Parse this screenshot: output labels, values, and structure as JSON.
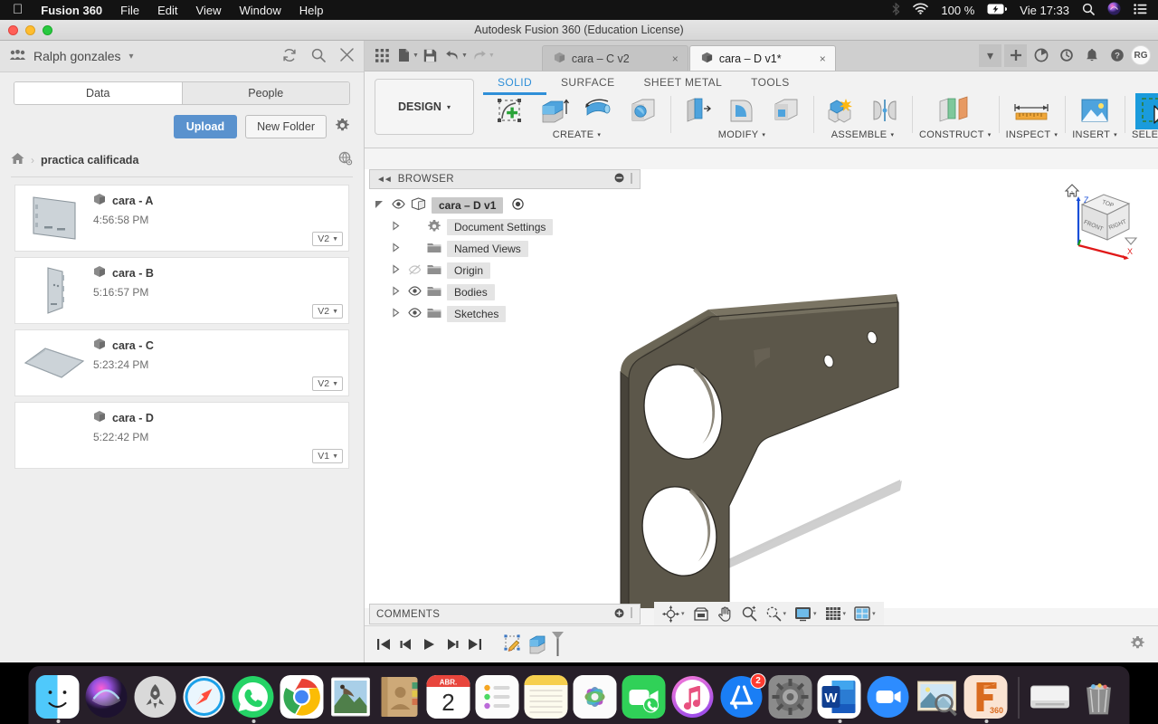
{
  "macbar": {
    "apple_icon": "apple-logo",
    "app_name": "Fusion 360",
    "menus": [
      "File",
      "Edit",
      "View",
      "Window",
      "Help"
    ],
    "bluetooth_icon": "bluetooth-icon",
    "wifi_icon": "wifi-icon",
    "battery_percent": "100 %",
    "battery_icon": "battery-charging-icon",
    "clock": "Vie 17:33",
    "search_icon": "spotlight-search-icon",
    "siri_icon": "siri-icon",
    "controlcenter_icon": "control-center-icon"
  },
  "window": {
    "title": "Autodesk Fusion 360 (Education License)"
  },
  "data_panel": {
    "user_name": "Ralph gonzales",
    "group_icon": "people-group-icon",
    "caret_icon": "chevron-down-icon",
    "refresh_icon": "refresh-icon",
    "search_icon": "search-icon",
    "close_icon": "close-icon",
    "tabs": [
      {
        "label": "Data",
        "active": true
      },
      {
        "label": "People",
        "active": false
      }
    ],
    "upload_label": "Upload",
    "new_folder_label": "New Folder",
    "settings_icon": "gear-icon",
    "breadcrumb": {
      "home_icon": "home-icon",
      "separator": "›",
      "folder": "practica calificada",
      "globe_icon": "globe-share-icon"
    },
    "items": [
      {
        "name": "cara - A",
        "time": "4:56:58 PM",
        "version": "V2",
        "thumb": "plate-flat-thumb"
      },
      {
        "name": "cara - B",
        "time": "5:16:57 PM",
        "version": "V2",
        "thumb": "plate-tall-thumb"
      },
      {
        "name": "cara - C",
        "time": "5:23:24 PM",
        "version": "V2",
        "thumb": "plate-wide-thumb"
      },
      {
        "name": "cara - D",
        "time": "5:22:42 PM",
        "version": "V1",
        "thumb": "empty-thumb"
      }
    ]
  },
  "tabstrip": {
    "grid_icon": "app-grid-icon",
    "file_icon": "new-file-icon",
    "save_icon": "save-icon",
    "undo_icon": "undo-icon",
    "redo_icon": "redo-icon",
    "documents": [
      {
        "label": "cara – C v2",
        "active": false,
        "close": "×"
      },
      {
        "label": "cara – D v1*",
        "active": true,
        "close": "×"
      }
    ],
    "overflow_icon": "chevron-down-icon",
    "add_icon": "plus-icon",
    "job_icon": "job-status-icon",
    "history_icon": "recent-clock-icon",
    "notify_icon": "bell-icon",
    "help_icon": "help-icon",
    "avatar_initials": "RG"
  },
  "ribbon": {
    "design_label": "DESIGN",
    "design_caret": "▾",
    "tabs": [
      {
        "label": "SOLID",
        "active": true
      },
      {
        "label": "SURFACE",
        "active": false
      },
      {
        "label": "SHEET METAL",
        "active": false
      },
      {
        "label": "TOOLS",
        "active": false
      }
    ],
    "groups": [
      {
        "label": "CREATE",
        "caret": "▾",
        "icons": [
          "create-sketch-icon",
          "extrude-icon",
          "revolve-icon",
          "sphere-icon"
        ]
      },
      {
        "label": "MODIFY",
        "caret": "▾",
        "icons": [
          "press-pull-icon",
          "fillet-icon",
          "shell-icon"
        ]
      },
      {
        "label": "ASSEMBLE",
        "caret": "▾",
        "icons": [
          "new-component-icon",
          "joint-icon"
        ]
      },
      {
        "label": "CONSTRUCT",
        "caret": "▾",
        "icons": [
          "offset-plane-icon"
        ]
      },
      {
        "label": "INSPECT",
        "caret": "▾",
        "icons": [
          "measure-icon"
        ]
      },
      {
        "label": "INSERT",
        "caret": "▾",
        "icons": [
          "insert-image-icon"
        ]
      },
      {
        "label": "SELECT",
        "caret": "▾",
        "icons": [
          "select-window-icon"
        ],
        "selected": true
      }
    ]
  },
  "browser": {
    "title": "BROWSER",
    "collapse_icon": "double-arrow-left-icon",
    "minimize_icon": "minus-circle-icon",
    "resize_icon": "resize-handle-icon",
    "root": {
      "label": "cara – D v1",
      "eye": "eye-visible-icon",
      "radio": "radio-dot-icon",
      "twisty": "triangle-down-icon"
    },
    "nodes": [
      {
        "label": "Document Settings",
        "icon": "gear-icon",
        "eye": null,
        "twisty": "triangle-right-icon"
      },
      {
        "label": "Named Views",
        "icon": "folder-icon",
        "eye": null,
        "twisty": "triangle-right-icon"
      },
      {
        "label": "Origin",
        "icon": "folder-icon",
        "eye": "eye-hidden-icon",
        "twisty": "triangle-right-icon"
      },
      {
        "label": "Bodies",
        "icon": "folder-icon",
        "eye": "eye-visible-icon",
        "twisty": "triangle-right-icon"
      },
      {
        "label": "Sketches",
        "icon": "folder-icon",
        "eye": "eye-visible-icon",
        "twisty": "triangle-right-icon"
      }
    ]
  },
  "viewcube": {
    "faces": [
      "TOP",
      "FRONT",
      "RIGHT"
    ],
    "axis_x": "X",
    "axis_z": "Z",
    "home_icon": "home-view-icon",
    "menu_icon": "viewcube-menu-icon"
  },
  "model": {
    "body_color": "#5c574a",
    "shadow_color": "#c6c6c6",
    "description": "bracket-plate-body"
  },
  "comments": {
    "title": "COMMENTS",
    "add_icon": "plus-circle-icon",
    "resize_icon": "resize-handle-icon"
  },
  "navbar": {
    "items": [
      {
        "icon": "orbit-icon",
        "caret": "▾"
      },
      {
        "icon": "display-settings-icon",
        "caret": ""
      },
      {
        "icon": "pan-hand-icon",
        "caret": ""
      },
      {
        "icon": "zoom-icon",
        "caret": ""
      },
      {
        "icon": "fit-icon",
        "caret": "▾"
      },
      {
        "icon": "display-mode-icon",
        "caret": "▾"
      },
      {
        "icon": "grid-snap-icon",
        "caret": "▾"
      },
      {
        "icon": "viewports-icon",
        "caret": "▾"
      }
    ]
  },
  "timeline": {
    "buttons": [
      {
        "icon": "go-to-beginning-icon"
      },
      {
        "icon": "step-back-icon"
      },
      {
        "icon": "play-icon"
      },
      {
        "icon": "step-forward-icon"
      },
      {
        "icon": "go-to-end-icon"
      }
    ],
    "features": [
      {
        "icon": "sketch-feature-icon"
      },
      {
        "icon": "extrude-feature-icon"
      }
    ],
    "marker_icon": "timeline-marker-icon",
    "settings_icon": "gear-icon"
  },
  "dock": {
    "apps": [
      {
        "name": "finder",
        "running": true
      },
      {
        "name": "siri",
        "running": false
      },
      {
        "name": "launchpad",
        "running": false
      },
      {
        "name": "safari",
        "running": false
      },
      {
        "name": "whatsapp",
        "running": true
      },
      {
        "name": "chrome",
        "running": false
      },
      {
        "name": "mail-stamp",
        "running": false
      },
      {
        "name": "contacts",
        "running": false
      },
      {
        "name": "calendar",
        "running": false,
        "month": "ABR.",
        "day": "2"
      },
      {
        "name": "reminders",
        "running": false
      },
      {
        "name": "notes",
        "running": false
      },
      {
        "name": "photos",
        "running": false
      },
      {
        "name": "facetime",
        "running": false
      },
      {
        "name": "itunes",
        "running": false
      },
      {
        "name": "app-store",
        "running": false,
        "badge": "2"
      },
      {
        "name": "system-preferences",
        "running": false
      },
      {
        "name": "microsoft-word",
        "running": true
      },
      {
        "name": "zoom",
        "running": false
      },
      {
        "name": "preview",
        "running": false
      },
      {
        "name": "fusion-360",
        "running": true,
        "label": "360"
      },
      {
        "name": "disk",
        "running": false
      },
      {
        "name": "trash",
        "running": false
      }
    ]
  },
  "colors": {
    "accent_blue": "#2f8fd8",
    "select_highlight": "#1a9bdc",
    "upload_blue": "#5a92ce",
    "model_body": "#5c574a"
  }
}
